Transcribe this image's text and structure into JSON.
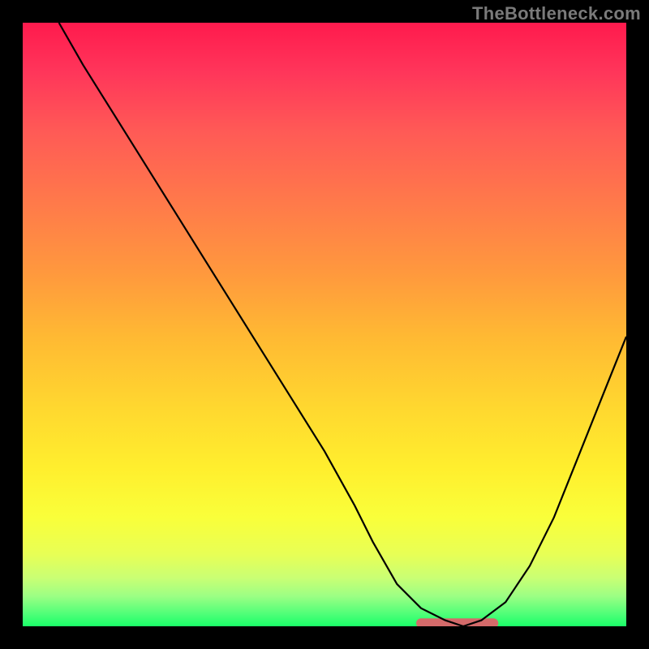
{
  "watermark": "TheBottleneck.com",
  "colors": {
    "gradient_top": "#ff1a4d",
    "gradient_mid": "#ffd82f",
    "gradient_bottom": "#1aff68",
    "frame": "#000000",
    "curve": "#000000",
    "flat_segment": "#d46a6a"
  },
  "chart_data": {
    "type": "line",
    "title": "",
    "xlabel": "",
    "ylabel": "",
    "xlim": [
      0,
      100
    ],
    "ylim": [
      0,
      100
    ],
    "grid": false,
    "series": [
      {
        "name": "bottleneck-curve",
        "x": [
          6,
          10,
          15,
          20,
          25,
          30,
          35,
          40,
          45,
          50,
          55,
          58,
          62,
          66,
          70,
          73,
          76,
          80,
          84,
          88,
          92,
          96,
          100
        ],
        "y": [
          100,
          93,
          85,
          77,
          69,
          61,
          53,
          45,
          37,
          29,
          20,
          14,
          7,
          3,
          1,
          0,
          1,
          4,
          10,
          18,
          28,
          38,
          48
        ]
      }
    ],
    "annotations": [
      {
        "name": "optimal-range",
        "x_start": 66,
        "x_end": 78,
        "y": 0.5
      }
    ]
  }
}
